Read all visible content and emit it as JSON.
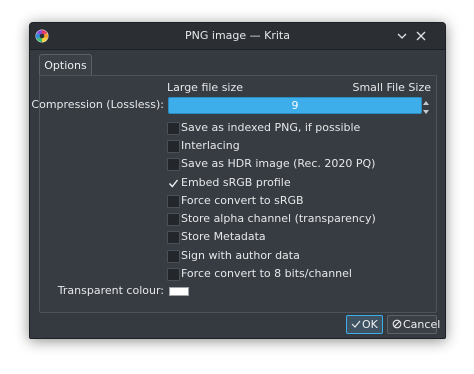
{
  "window": {
    "title": "PNG image — Krita"
  },
  "tabs": [
    {
      "label": "Options",
      "active": true
    }
  ],
  "compression": {
    "label": "Compression (Lossless):",
    "left_label": "Large file size",
    "right_label": "Small File Size",
    "value": "9"
  },
  "options": [
    {
      "label": "Save as indexed PNG, if possible",
      "checked": false
    },
    {
      "label": "Interlacing",
      "checked": false
    },
    {
      "label": "Save as HDR image (Rec. 2020 PQ)",
      "checked": false
    },
    {
      "label": "Embed sRGB profile",
      "checked": true
    },
    {
      "label": "Force convert to sRGB",
      "checked": false
    },
    {
      "label": "Store alpha channel (transparency)",
      "checked": false
    },
    {
      "label": "Store Metadata",
      "checked": false
    },
    {
      "label": "Sign with author data",
      "checked": false
    },
    {
      "label": "Force convert to 8 bits/channel",
      "checked": false
    }
  ],
  "transparent": {
    "label": "Transparent colour:",
    "color": "#ffffff"
  },
  "buttons": {
    "ok": "OK",
    "cancel": "Cancel"
  },
  "colors": {
    "accent": "#3daee9",
    "window_bg": "#353a40",
    "titlebar_bg": "#2b2f34"
  }
}
